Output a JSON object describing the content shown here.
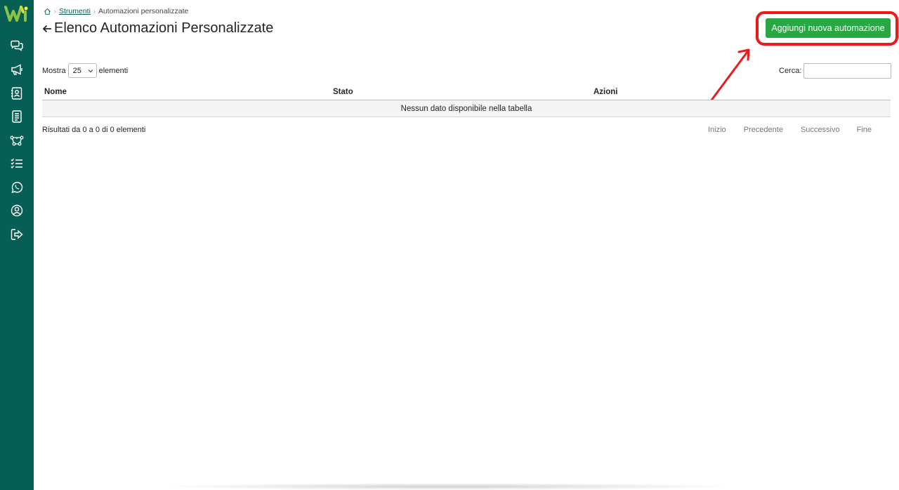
{
  "sidebar": {
    "logo_icon": "brand-logo-w",
    "items": [
      {
        "name": "chat",
        "icon": "chat-bubbles-icon"
      },
      {
        "name": "campaigns",
        "icon": "megaphone-icon"
      },
      {
        "name": "contacts",
        "icon": "contact-card-icon"
      },
      {
        "name": "templates",
        "icon": "document-list-icon"
      },
      {
        "name": "automations",
        "icon": "workflow-nodes-icon"
      },
      {
        "name": "tasks",
        "icon": "checklist-icon"
      },
      {
        "name": "whatsapp",
        "icon": "whatsapp-icon"
      },
      {
        "name": "profile",
        "icon": "user-circle-icon"
      },
      {
        "name": "logout",
        "icon": "logout-icon"
      }
    ],
    "color": "#075e54"
  },
  "breadcrumb": {
    "home_icon": "home-icon",
    "link": "Strumenti",
    "current": "Automazioni personalizzate"
  },
  "header": {
    "title": "Elenco Automazioni Personalizzate",
    "add_button": "Aggiungi nuova automazione",
    "button_color": "#28a745",
    "highlight_color": "#ee1a1a"
  },
  "controls": {
    "show_label": "Mostra",
    "page_size": "25",
    "elements_label": "elementi",
    "search_label": "Cerca:",
    "search_value": ""
  },
  "table": {
    "columns": [
      "Nome",
      "Stato",
      "Azioni"
    ],
    "empty_message": "Nessun dato disponibile nella tabella"
  },
  "footer": {
    "info": "Risultati da 0 a 0 di 0 elementi",
    "pagination": {
      "first": "Inizio",
      "previous": "Precedente",
      "next": "Successivo",
      "last": "Fine"
    }
  }
}
